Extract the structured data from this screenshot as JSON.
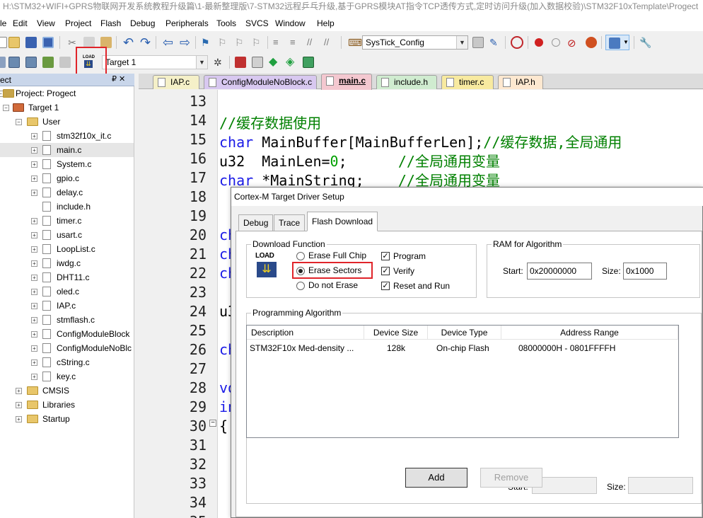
{
  "title": "H:\\STM32+WIFI+GPRS物联网开发系统教程升级篇\\1-最新整理版\\7-STM32远程乒乓升级,基于GPRS模块AT指令TCP透传方式,定时访问升级(加入数据校验)\\STM32F10xTemplate\\Progect",
  "menu": [
    "le",
    "Edit",
    "View",
    "Project",
    "Flash",
    "Debug",
    "Peripherals",
    "Tools",
    "SVCS",
    "Window",
    "Help"
  ],
  "toolbar": {
    "function_combo": "SysTick_Config",
    "target_combo": "Target 1",
    "load_icon_text": "LOAD"
  },
  "project_panel": {
    "header": "ect",
    "pin": "₽ ✕",
    "root": "Project: Progect",
    "target": "Target 1",
    "groups": [
      "User",
      "CMSIS",
      "Libraries",
      "Startup"
    ],
    "user_files": [
      "stm32f10x_it.c",
      "main.c",
      "System.c",
      "gpio.c",
      "delay.c",
      "include.h",
      "timer.c",
      "usart.c",
      "LoopList.c",
      "iwdg.c",
      "DHT11.c",
      "oled.c",
      "IAP.c",
      "stmflash.c",
      "ConfigModuleBlock",
      "ConfigModuleNoBlc",
      "cString.c",
      "key.c"
    ]
  },
  "tabs": [
    {
      "label": "IAP.c",
      "color": "#f5f0c8"
    },
    {
      "label": "ConfigModuleNoBlock.c",
      "color": "#d8c8f0"
    },
    {
      "label": "main.c",
      "color": "#f4c8d0"
    },
    {
      "label": "include.h",
      "color": "#d0ecd0"
    },
    {
      "label": "timer.c",
      "color": "#f8eaa0"
    },
    {
      "label": "IAP.h",
      "color": "#fde8d0"
    }
  ],
  "editor": {
    "line_numbers": [
      "13",
      "14",
      "15",
      "16",
      "17",
      "18",
      "19",
      "20",
      "21",
      "22",
      "23",
      "24",
      "25",
      "26",
      "27",
      "28",
      "29",
      "30",
      "31",
      "32",
      "33",
      "34",
      "35"
    ],
    "line14": "//缓存数据使用",
    "line15_kw": "char",
    "line15_rest": " MainBuffer[MainBufferLen];",
    "line15_cm": "//缓存数据,全局通用",
    "line16_a": "u32  MainLen=",
    "line16_num": "0",
    "line16_b": ";      ",
    "line16_cm": "//全局通用变量",
    "line17_kw": "char",
    "line17_rest": " *MainString;    ",
    "line17_cm": "//全局通用变量",
    "line20": "ch",
    "line21": "ch",
    "line22": "ch",
    "line24": "u3",
    "line26": "ch",
    "line28": "vo",
    "line29": "in",
    "line30": "{"
  },
  "dialog": {
    "title": "Cortex-M Target Driver Setup",
    "tabs": [
      "Debug",
      "Trace",
      "Flash Download"
    ],
    "download_function": {
      "label": "Download Function",
      "load_text": "LOAD",
      "radios": [
        "Erase Full Chip",
        "Erase Sectors",
        "Do not Erase"
      ],
      "selected": "Erase Sectors",
      "checks": [
        "Program",
        "Verify",
        "Reset and Run"
      ]
    },
    "ram": {
      "label": "RAM for Algorithm",
      "start_label": "Start:",
      "start_value": "0x20000000",
      "size_label": "Size:",
      "size_value": "0x1000"
    },
    "programming": {
      "label": "Programming Algorithm",
      "columns": [
        "Description",
        "Device Size",
        "Device Type",
        "Address Range"
      ],
      "rows": [
        {
          "description": "STM32F10x Med-density ...",
          "size": "128k",
          "type": "On-chip Flash",
          "range": "08000000H - 0801FFFFH"
        }
      ],
      "start_label": "Start:",
      "size_label": "Size:"
    },
    "buttons": {
      "add": "Add",
      "remove": "Remove"
    }
  }
}
